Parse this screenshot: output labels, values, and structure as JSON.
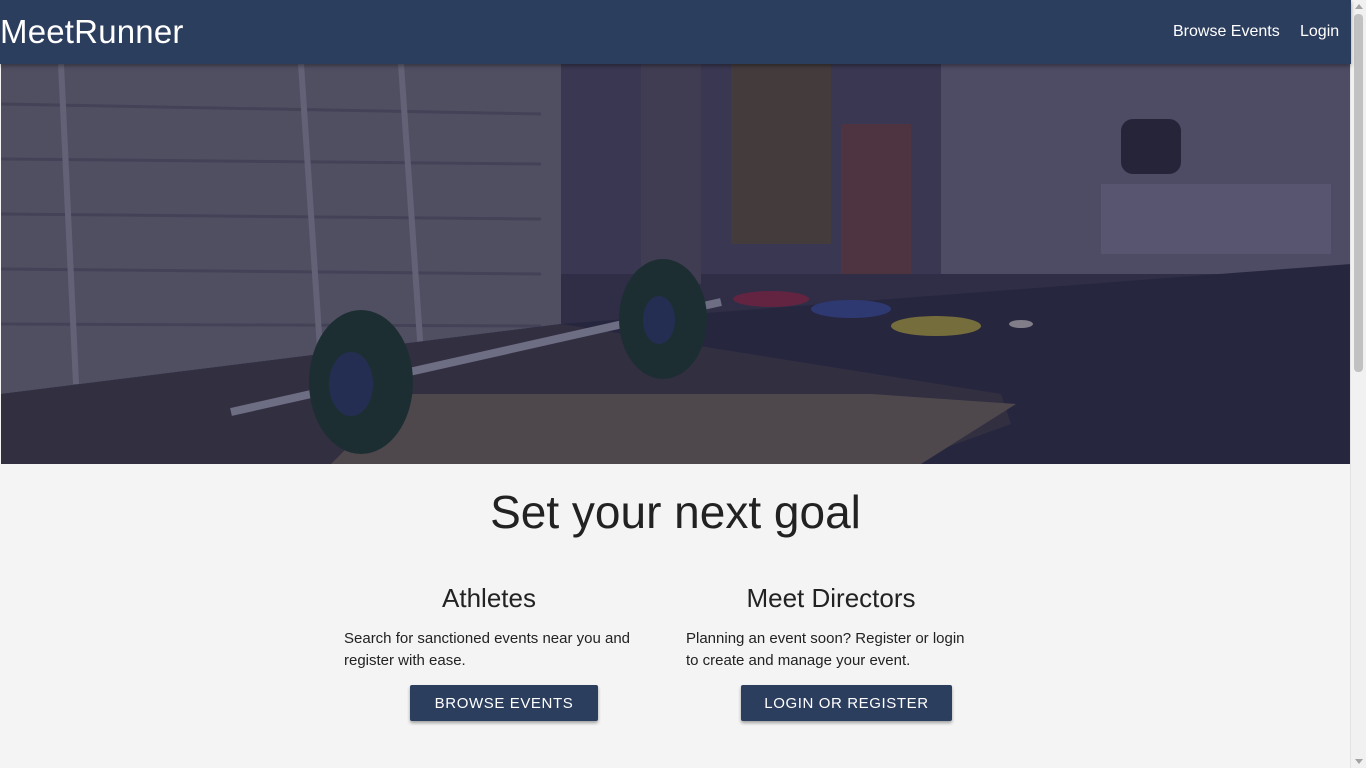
{
  "navbar": {
    "brand": "MeetRunner",
    "links": [
      {
        "label": "Browse Events"
      },
      {
        "label": "Login"
      }
    ]
  },
  "hero": {
    "image_subject": "barbell-gym-photo"
  },
  "main": {
    "headline": "Set your next goal",
    "athletes": {
      "heading": "Athletes",
      "description": "Search for sanctioned events near you and register with ease.",
      "button_label": "BROWSE EVENTS"
    },
    "directors": {
      "heading": "Meet Directors",
      "description": "Planning an event soon? Register or login to create and manage your event.",
      "button_label": "LOGIN OR REGISTER"
    }
  },
  "colors": {
    "navbar": "#2c3e5e",
    "button": "#2c3e5e",
    "page_background": "#f4f4f4"
  }
}
